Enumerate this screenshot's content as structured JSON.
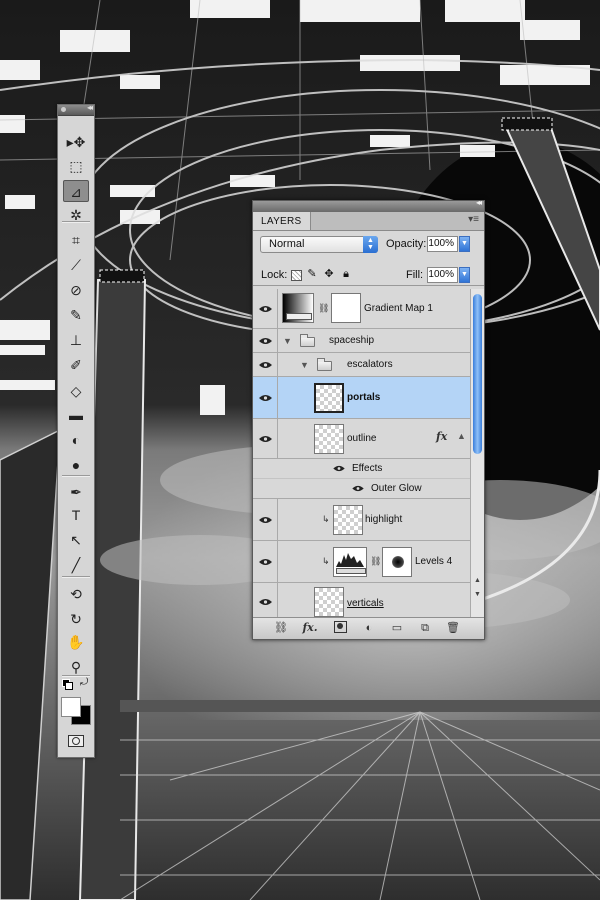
{
  "tools_palette": {
    "tools": [
      {
        "icon": "move-icon",
        "glyph": "▸✥"
      },
      {
        "icon": "marquee-icon",
        "glyph": "⬚"
      },
      {
        "icon": "polygonal-lasso-icon",
        "glyph": "⊿"
      },
      {
        "icon": "magic-wand-icon",
        "glyph": "✲"
      },
      {
        "icon": "crop-icon",
        "glyph": "⌗"
      },
      {
        "icon": "eyedropper-icon",
        "glyph": "⟋"
      },
      {
        "icon": "spot-healing-icon",
        "glyph": "⊘"
      },
      {
        "icon": "brush-icon",
        "glyph": "✎"
      },
      {
        "icon": "clone-stamp-icon",
        "glyph": "⊥"
      },
      {
        "icon": "history-brush-icon",
        "glyph": "✐"
      },
      {
        "icon": "eraser-icon",
        "glyph": "◇"
      },
      {
        "icon": "gradient-icon",
        "glyph": "▬"
      },
      {
        "icon": "blur-icon",
        "glyph": "◐"
      },
      {
        "icon": "dodge-icon",
        "glyph": "●"
      },
      {
        "icon": "pen-icon",
        "glyph": "✒"
      },
      {
        "icon": "type-icon",
        "glyph": "T"
      },
      {
        "icon": "path-selection-icon",
        "glyph": "↖"
      },
      {
        "icon": "line-icon",
        "glyph": "╱"
      },
      {
        "icon": "3d-rotate-icon",
        "glyph": "⟲"
      },
      {
        "icon": "3d-orbit-icon",
        "glyph": "↻"
      },
      {
        "icon": "hand-icon",
        "glyph": "✋"
      },
      {
        "icon": "zoom-icon",
        "glyph": "⚲"
      }
    ],
    "active_tool": "polygonal-lasso-icon"
  },
  "layers_panel": {
    "tab_label": "LAYERS",
    "blend_mode": "Normal",
    "opacity_label": "Opacity:",
    "opacity_value": "100%",
    "lock_label": "Lock:",
    "fill_label": "Fill:",
    "fill_value": "100%",
    "layers": [
      {
        "name": "Gradient Map 1"
      },
      {
        "name": "spaceship"
      },
      {
        "name": "escalators"
      },
      {
        "name": "portals"
      },
      {
        "name": "outline"
      },
      {
        "name": "Effects"
      },
      {
        "name": "Outer Glow"
      },
      {
        "name": "highlight"
      },
      {
        "name": "Levels 4"
      },
      {
        "name": "verticals"
      }
    ],
    "selected_layer": "portals",
    "colors": {
      "selection": "#b4d4f6",
      "accent": "#2f74d6"
    }
  }
}
